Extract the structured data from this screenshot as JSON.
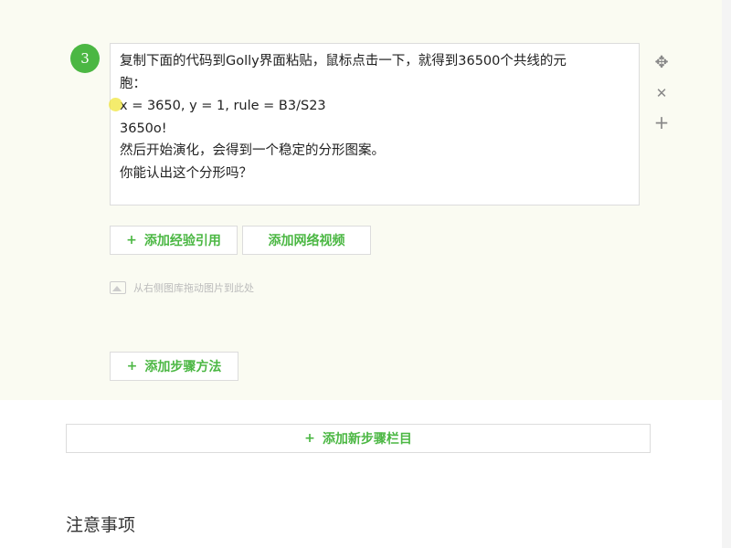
{
  "step": {
    "number": "3",
    "lines": [
      "复制下面的代码到Golly界面粘贴，鼠标点击一下，就得到36500个共线的元",
      "胞：",
      "x = 3650, y = 1, rule = B3/S23",
      "3650o!",
      "然后开始演化，会得到一个稳定的分形图案。",
      "你能认出这个分形吗？"
    ]
  },
  "side_icons": [
    "move-icon",
    "close-icon",
    "plus-icon"
  ],
  "side_glyphs": {
    "move": "✥",
    "close": "✕",
    "add": "+"
  },
  "buttons": {
    "add_experience_ref": "添加经验引用",
    "add_web_video": "添加网络视频",
    "add_step_method": "添加步骤方法",
    "add_new_step_column": "添加新步骤栏目",
    "plus": "+"
  },
  "drag_hint": "从右侧图库拖动图片到此处",
  "notes_title": "注意事项",
  "colors": {
    "accent": "#4bb743",
    "panel_bg": "#fafbf2"
  }
}
